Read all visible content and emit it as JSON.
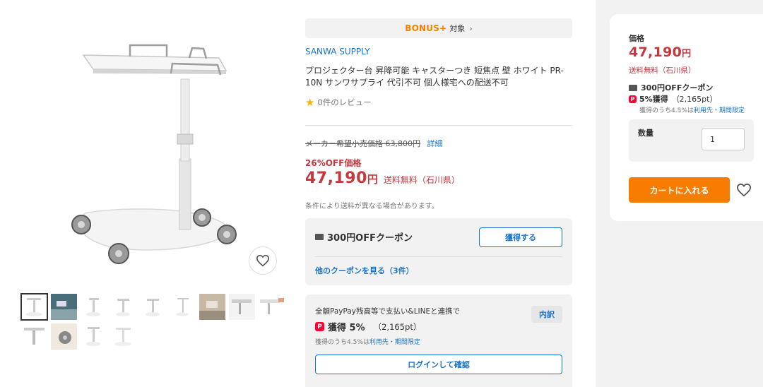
{
  "bonus_bar": {
    "logo": "BONUS+",
    "label": "対象",
    "chevron": "›"
  },
  "product": {
    "brand": "SANWA SUPPLY",
    "title": "プロジェクター台 昇降可能 キャスターつき 短焦点 壁 ホワイト PR-10N サンワサプライ 代引不可 個人様宅への配送不可",
    "review_text": "0件のレビュー",
    "list_price": "メーカー希望小売価格 63,800円",
    "detail_link": "詳細",
    "off_label": "26%OFF価格",
    "price": "47,190",
    "yen": "円",
    "shipping": "送料無料（石川県）",
    "shipping_note": "条件により送料が異なる場合があります。"
  },
  "coupon": {
    "title": "300円OFFクーポン",
    "get_button": "獲得する",
    "more_link": "他のクーポンを見る（3件）"
  },
  "paypay": {
    "description": "全額PayPay残高等で支払い&LINEと連携で",
    "breakdown_button": "内訳",
    "icon_glyph": "P",
    "earn": "獲得 5%",
    "points": "（2,165pt）",
    "sub_prefix": "獲得のうち4.5%は",
    "sub_link": "利用先・期間限定",
    "login_button": "ログインして確認"
  },
  "cart_panel": {
    "price_label": "価格",
    "price": "47,190",
    "yen": "円",
    "shipping": "送料無料（石川県）",
    "coupon": "300円OFFクーポン",
    "pp_earn": "5%獲得",
    "pp_points": "（2,165pt）",
    "sub_prefix": "獲得のうち4.5%は",
    "sub_link": "利用先・期間限定",
    "quantity_label": "数量",
    "quantity_value": "1",
    "add_to_cart": "カートに入れる"
  },
  "colors": {
    "price_red": "#c5383e",
    "link_blue": "#1a73c8",
    "cart_orange": "#f87c00",
    "bonus_orange": "#f08200",
    "paypay_red": "#ff0033"
  },
  "gallery": {
    "selected_index": 0,
    "thumbnail_count": 13
  }
}
